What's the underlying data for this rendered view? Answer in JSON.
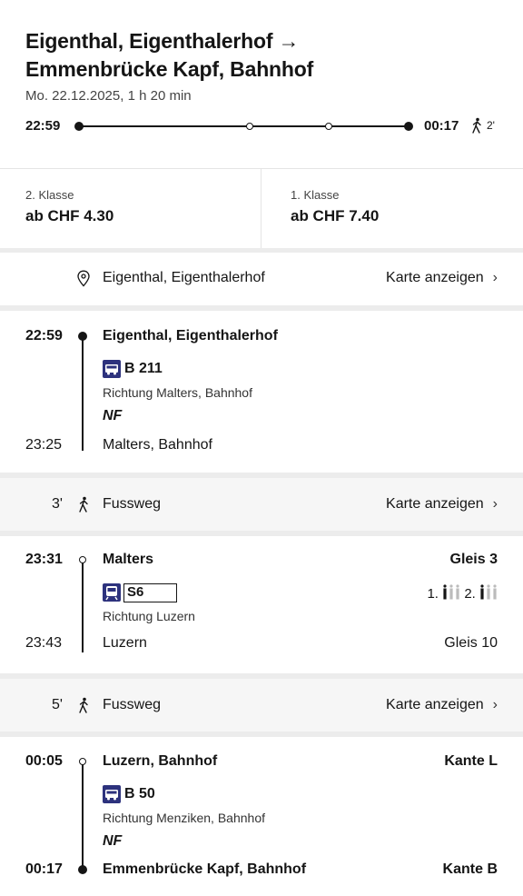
{
  "header": {
    "title_line1": "Eigenthal, Eigenthalerhof →",
    "title_line2": "Emmenbrücke Kapf, Bahnhof",
    "subtitle": "Mo. 22.12.2025, 1 h 20 min",
    "depart": "22:59",
    "arrive": "00:17",
    "walk_end": "2'"
  },
  "prices": {
    "second": {
      "class": "2. Klasse",
      "value": "ab CHF 4.30"
    },
    "first": {
      "class": "1. Klasse",
      "value": "ab CHF 7.40"
    }
  },
  "start_location": {
    "name": "Eigenthal, Eigenthalerhof",
    "map_label": "Karte anzeigen",
    "icon": "map-pin-icon"
  },
  "legs": [
    {
      "dep_time": "22:59",
      "dep_stop": "Eigenthal, Eigenthalerhof",
      "icon": "bus-icon",
      "line": "B 211",
      "direction": "Richtung Malters, Bahnhof",
      "note": "NF",
      "arr_time": "23:25",
      "arr_stop": "Malters, Bahnhof"
    },
    {
      "dep_time": "23:31",
      "dep_stop": "Malters",
      "dep_platform": "Gleis 3",
      "icon": "train-icon",
      "line": "S6",
      "occupancy_first": "1.",
      "occupancy_second": "2.",
      "direction": "Richtung Luzern",
      "arr_time": "23:43",
      "arr_stop": "Luzern",
      "arr_platform": "Gleis 10"
    },
    {
      "dep_time": "00:05",
      "dep_stop": "Luzern, Bahnhof",
      "dep_platform": "Kante L",
      "icon": "bus-icon",
      "line": "B 50",
      "direction": "Richtung Menziken, Bahnhof",
      "note": "NF",
      "arr_time": "00:17",
      "arr_stop": "Emmenbrücke Kapf, Bahnhof",
      "arr_platform": "Kante B"
    }
  ],
  "walks": [
    {
      "minutes": "3'",
      "label": "Fussweg",
      "map_label": "Karte anzeigen"
    },
    {
      "minutes": "5'",
      "label": "Fussweg",
      "map_label": "Karte anzeigen"
    }
  ],
  "colors": {
    "accent": "#2d327d",
    "text": "#151515",
    "separator": "#ececec"
  }
}
